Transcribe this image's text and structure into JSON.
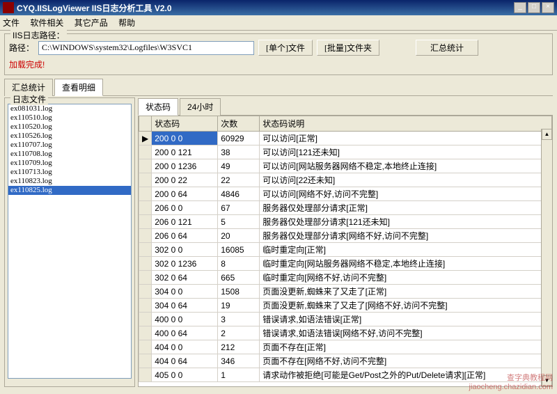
{
  "window": {
    "title": "CYQ.IISLogViewer IIS日志分析工具 V2.0",
    "min": "_",
    "max": "□",
    "close": "×"
  },
  "menu": {
    "file": "文件",
    "software": "软件相关",
    "other": "其它产品",
    "help": "帮助"
  },
  "pathbox": {
    "legend": "IIS日志路径：",
    "label": "路径：",
    "value": "C:\\WINDOWS\\system32\\Logfiles\\W3SVC1",
    "btn_single": "[单个]文件",
    "btn_batch": "[批量]文件夹",
    "btn_stats": "汇总统计",
    "status": "加载完成!"
  },
  "maintabs": {
    "summary": "汇总统计",
    "detail": "查看明细"
  },
  "filelist": {
    "legend": "日志文件",
    "items": [
      "ex081031.log",
      "ex110510.log",
      "ex110520.log",
      "ex110526.log",
      "ex110707.log",
      "ex110708.log",
      "ex110709.log",
      "ex110713.log",
      "ex110823.log",
      "ex110825.log"
    ],
    "selected": "ex110825.log"
  },
  "subtabs": {
    "status": "状态码",
    "hour": "24小时"
  },
  "grid": {
    "headers": {
      "c0": "状态码",
      "c1": "次数",
      "c2": "状态码说明"
    },
    "rowmark": "▶",
    "rows": [
      {
        "c0": "200 0 0",
        "c1": "60929",
        "c2": "可以访问[正常]",
        "sel": true
      },
      {
        "c0": "200 0 121",
        "c1": "38",
        "c2": "可以访问[121还未知]"
      },
      {
        "c0": "200 0 1236",
        "c1": "49",
        "c2": "可以访问[网站服务器网络不稳定,本地终止连接]"
      },
      {
        "c0": "200 0 22",
        "c1": "22",
        "c2": "可以访问[22还未知]"
      },
      {
        "c0": "200 0 64",
        "c1": "4846",
        "c2": "可以访问[网络不好,访问不完整]"
      },
      {
        "c0": "206 0 0",
        "c1": "67",
        "c2": "服务器仅处理部分请求[正常]"
      },
      {
        "c0": "206 0 121",
        "c1": "5",
        "c2": "服务器仅处理部分请求[121还未知]"
      },
      {
        "c0": "206 0 64",
        "c1": "20",
        "c2": "服务器仅处理部分请求[网络不好,访问不完整]"
      },
      {
        "c0": "302 0 0",
        "c1": "16085",
        "c2": "临时重定向[正常]"
      },
      {
        "c0": "302 0 1236",
        "c1": "8",
        "c2": "临时重定向[网站服务器网络不稳定,本地终止连接]"
      },
      {
        "c0": "302 0 64",
        "c1": "665",
        "c2": "临时重定向[网络不好,访问不完整]"
      },
      {
        "c0": "304 0 0",
        "c1": "1508",
        "c2": "页面没更新,蜘蛛来了又走了[正常]"
      },
      {
        "c0": "304 0 64",
        "c1": "19",
        "c2": "页面没更新,蜘蛛来了又走了[网络不好,访问不完整]"
      },
      {
        "c0": "400 0 0",
        "c1": "3",
        "c2": "错误请求,如语法错误[正常]"
      },
      {
        "c0": "400 0 64",
        "c1": "2",
        "c2": "错误请求,如语法错误[网络不好,访问不完整]"
      },
      {
        "c0": "404 0 0",
        "c1": "212",
        "c2": "页面不存在[正常]"
      },
      {
        "c0": "404 0 64",
        "c1": "346",
        "c2": "页面不存在[网络不好,访问不完整]"
      },
      {
        "c0": "405 0 0",
        "c1": "1",
        "c2": "请求动作被拒绝[可能是Get/Post之外的Put/Delete请求][正常]"
      }
    ]
  },
  "watermark": {
    "l1": "查字典教程网",
    "l2": "jiaocheng.chazidian.com"
  }
}
